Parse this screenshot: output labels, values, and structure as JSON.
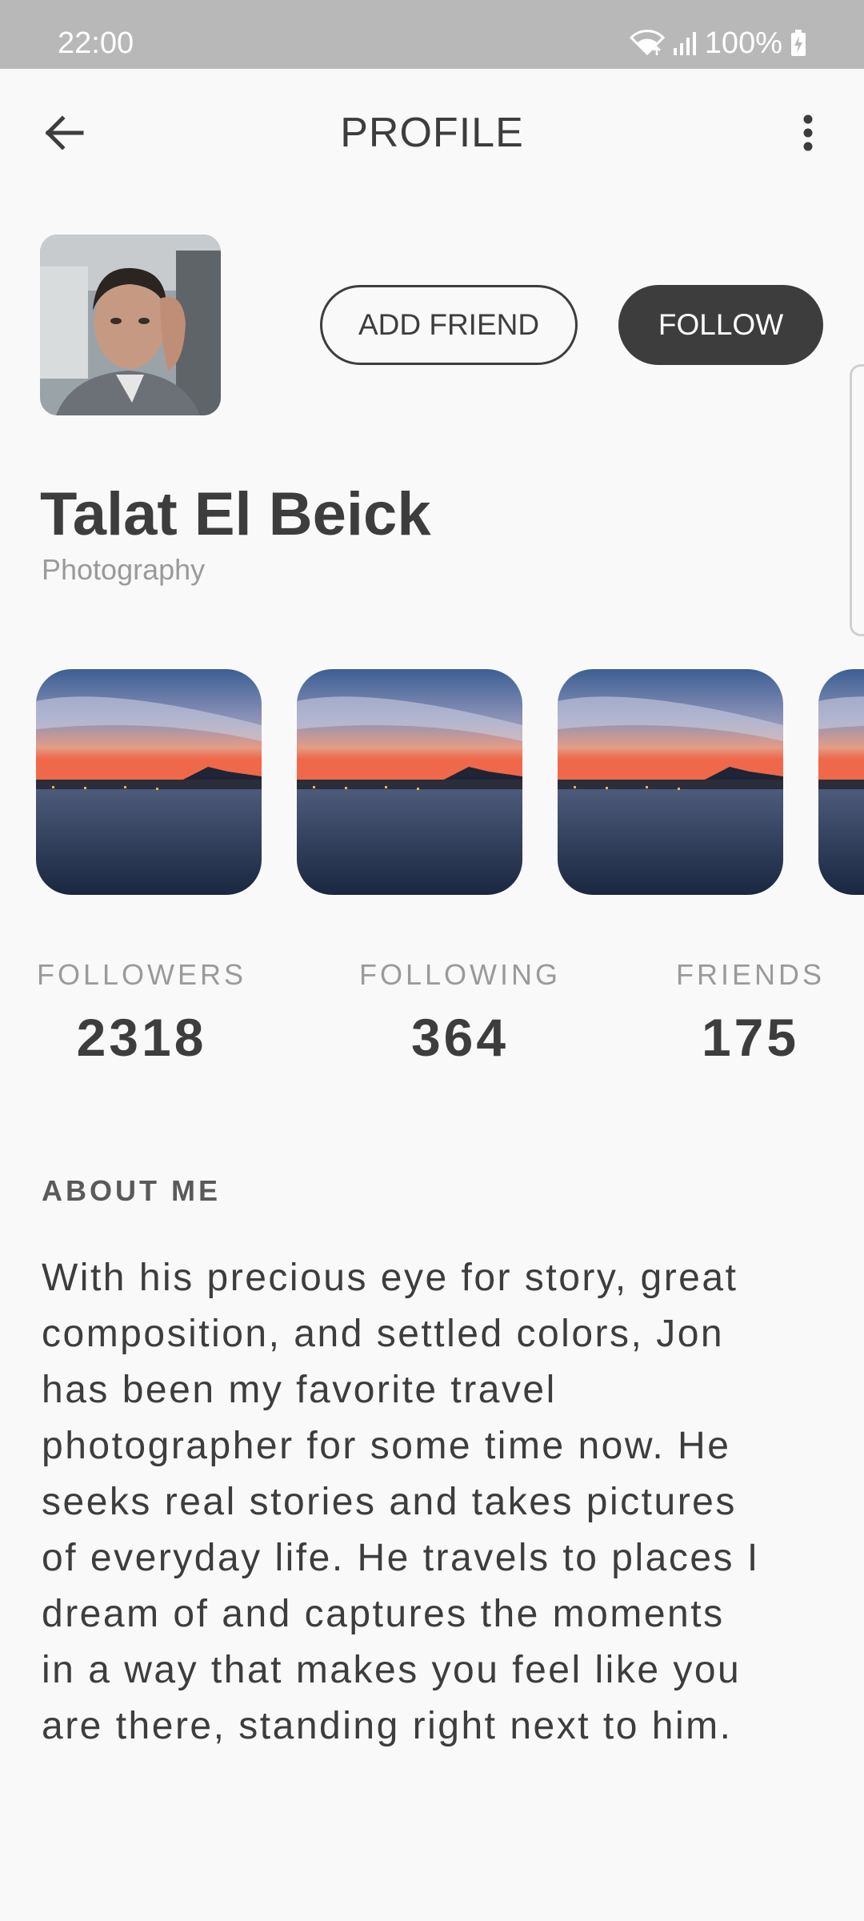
{
  "status_bar": {
    "time": "22:00",
    "battery": "100%",
    "icons": [
      "wifi-icon",
      "signal-icon",
      "battery-charging-icon"
    ]
  },
  "app_bar": {
    "title": "PROFILE",
    "back_icon": "arrow-back-icon",
    "menu_icon": "more-vert-icon"
  },
  "profile": {
    "name": "Talat El Beick",
    "category": "Photography",
    "actions": {
      "add_friend": "ADD FRIEND",
      "follow": "FOLLOW"
    }
  },
  "gallery": {
    "count_visible": 4,
    "subject": "sunset over bay with mountain"
  },
  "stats": [
    {
      "label": "FOLLOWERS",
      "value": "2318"
    },
    {
      "label": "FOLLOWING",
      "value": "364"
    },
    {
      "label": "FRIENDS",
      "value": "175"
    }
  ],
  "about": {
    "heading": "ABOUT ME",
    "lines": [
      "With his precious eye for story, great",
      "composition, and settled colors, Jon",
      "has been my favorite travel",
      "photographer for some time now. He",
      "seeks real stories and takes pictures",
      "of everyday life. He travels to places I",
      "dream of and captures the moments",
      "in a way that makes you feel like you",
      "are there, standing right next to him."
    ]
  },
  "colors": {
    "background": "#f9f9fa",
    "status_bar": "#b8b8b8",
    "primary_text": "#3d3d3d",
    "secondary_text": "#9a9a9a",
    "follow_button": "#3d3d3d"
  }
}
